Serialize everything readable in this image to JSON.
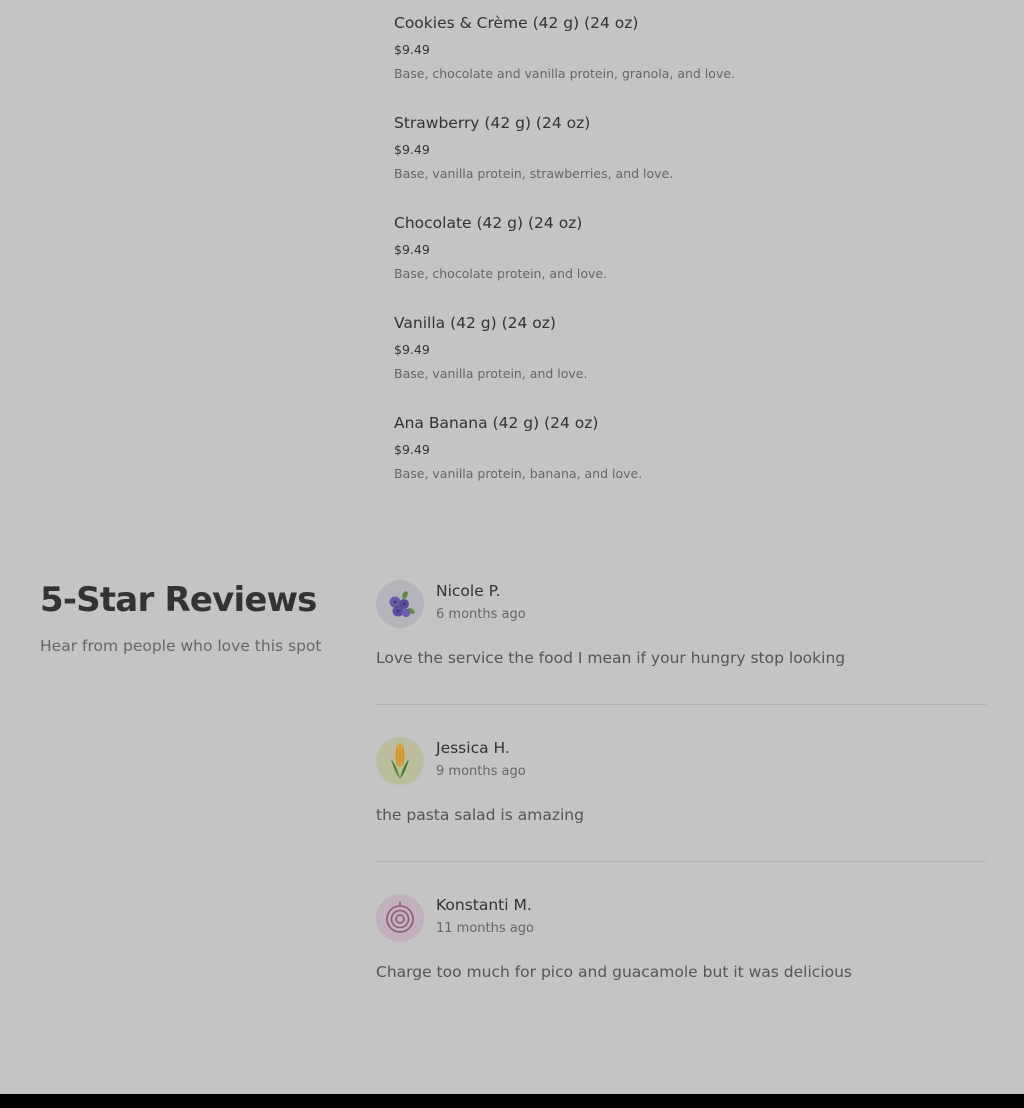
{
  "menu": {
    "items": [
      {
        "name": "Cookies & Crème (42 g) (24 oz)",
        "price": "$9.49",
        "description": "Base, chocolate and vanilla protein, granola, and love."
      },
      {
        "name": "Strawberry (42 g) (24 oz)",
        "price": "$9.49",
        "description": "Base, vanilla protein, strawberries, and love."
      },
      {
        "name": "Chocolate (42 g) (24 oz)",
        "price": "$9.49",
        "description": "Base, chocolate protein, and love."
      },
      {
        "name": "Vanilla (42 g) (24 oz)",
        "price": "$9.49",
        "description": "Base, vanilla protein, and love."
      },
      {
        "name": "Ana Banana (42 g) (24 oz)",
        "price": "$9.49",
        "description": "Base, vanilla protein, banana, and love."
      }
    ]
  },
  "reviews": {
    "heading": "5-Star Reviews",
    "subtitle": "Hear from people who love this spot",
    "items": [
      {
        "name": "Nicole P.",
        "date": "6 months ago",
        "text": "Love the service the food I mean if your hungry stop looking",
        "avatar_icon": "blueberries-icon"
      },
      {
        "name": "Jessica H.",
        "date": "9 months ago",
        "text": "the pasta salad is amazing",
        "avatar_icon": "corn-icon"
      },
      {
        "name": "Konstanti M.",
        "date": "11 months ago",
        "text": "Charge too much for pico and guacamole but it was delicious",
        "avatar_icon": "onion-icon"
      }
    ]
  },
  "colors": {
    "page_background": "#c4c4c4",
    "primary_text": "#333333",
    "secondary_text": "#666666",
    "footer": "#000000"
  }
}
